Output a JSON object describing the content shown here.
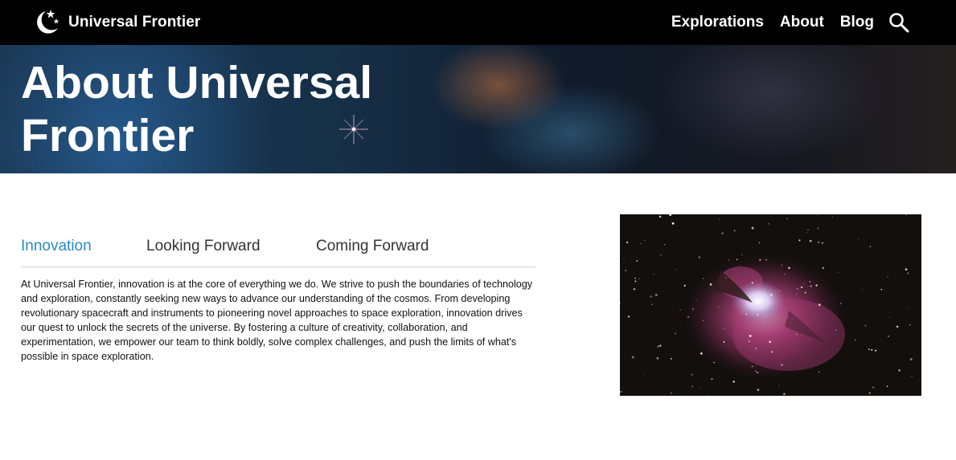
{
  "header": {
    "brand_name": "Universal Frontier",
    "logo_icon": "moon-stars-icon",
    "nav": [
      {
        "label": "Explorations"
      },
      {
        "label": "About"
      },
      {
        "label": "Blog"
      }
    ],
    "search_icon": "search-icon"
  },
  "hero": {
    "title": "About Universal Frontier"
  },
  "tabs": {
    "items": [
      {
        "label": "Innovation",
        "active": true
      },
      {
        "label": "Looking Forward",
        "active": false
      },
      {
        "label": "Coming Forward",
        "active": false
      }
    ],
    "content": "At Universal Frontier, innovation is at the core of everything we do. We strive to push the boundaries of technology and exploration, constantly seeking new ways to advance our understanding of the cosmos. From developing revolutionary spacecraft and instruments to pioneering novel approaches to space exploration, innovation drives our quest to unlock the secrets of the universe. By fostering a culture of creativity, collaboration, and experimentation, we empower our team to think boldly, solve complex challenges, and push the limits of what's possible in space exploration."
  },
  "colors": {
    "topbar": "#000000",
    "active_tab": "#2a8bc7",
    "tab_text": "#333333",
    "divider": "#cfcfcf"
  }
}
